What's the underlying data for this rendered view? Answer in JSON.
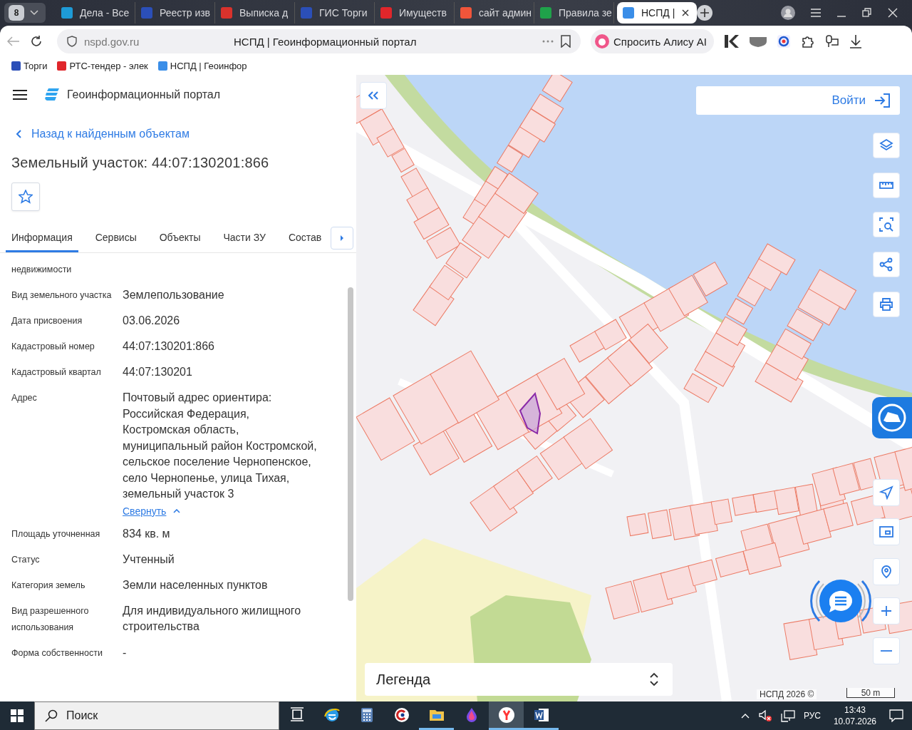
{
  "browser": {
    "tab_count": "8",
    "tabs": [
      {
        "title": "Дела - Все",
        "color": "#1e9bd7",
        "selected": false
      },
      {
        "title": "Реестр изв",
        "color": "#2b4fb8",
        "selected": false
      },
      {
        "title": "Выписка д",
        "color": "#d8322c",
        "selected": false
      },
      {
        "title": "ГИС Торги",
        "color": "#2b4fb8",
        "selected": false
      },
      {
        "title": "Имуществ",
        "color": "#e0262b",
        "selected": false
      },
      {
        "title": "сайт админ",
        "color": "#f0553a",
        "selected": false
      },
      {
        "title": "Правила зе",
        "color": "#1fa24a",
        "selected": false
      },
      {
        "title": "НСПД |",
        "color": "#3a8ee8",
        "selected": true
      }
    ],
    "address": {
      "host": "nspd.gov.ru",
      "page_title": "НСПД | Геоинформационный портал"
    },
    "alice_button": "Спросить Алису AI",
    "bookmarks": [
      {
        "title": "Торги",
        "color": "#2b4fb8"
      },
      {
        "title": "РТС-тендер - элек",
        "color": "#e0262b"
      },
      {
        "title": "НСПД | Геоинфор",
        "color": "#3a8ee8"
      }
    ]
  },
  "portal": {
    "title": "Геоинформационный портал",
    "back_link": "Назад к найденным объектам",
    "heading": "Земельный участок: 44:07:130201:866",
    "tabs": [
      {
        "label": "Информация",
        "selected": true
      },
      {
        "label": "Сервисы",
        "selected": false
      },
      {
        "label": "Объекты",
        "selected": false
      },
      {
        "label": "Части ЗУ",
        "selected": false
      },
      {
        "label": "Состав",
        "selected": false
      }
    ],
    "fields": [
      {
        "label": "недвижимости"
      },
      {
        "label": "Вид земельного участка",
        "value": "Землепользование"
      },
      {
        "label": "Дата присвоения",
        "value": "03.06.2026"
      },
      {
        "label": "Кадастровый номер",
        "value": "44:07:130201:866"
      },
      {
        "label": "Кадастровый квартал",
        "value": "44:07:130201"
      },
      {
        "label": "Адрес",
        "value": "Почтовый адрес ориентира:\nРоссийская Федерация,\nКостромская область,\nмуниципальный район Костромской,\nсельское поселение Чернопенское,\nсело Чернопенье, улица Тихая,\nземельный участок 3",
        "collapse_link": "Свернуть"
      },
      {
        "label": "Площадь уточненная",
        "value": "834 кв. м"
      },
      {
        "label": "Статус",
        "value": "Учтенный"
      },
      {
        "label": "Категория земель",
        "value": "Земли населенных пунктов"
      },
      {
        "label": "Вид разрешенного использования",
        "value": "Для индивидуального жилищного строительства"
      },
      {
        "label": "Форма собственности",
        "value": "-"
      }
    ]
  },
  "map": {
    "login_button": "Войти",
    "legend": "Легенда",
    "attribution": "НСПД 2026 ©",
    "scale": "50 m"
  },
  "taskbar": {
    "search_placeholder": "Поиск",
    "apps": [
      {
        "kind": "task-view",
        "running": false,
        "selected": false
      },
      {
        "kind": "browser-e",
        "running": false,
        "selected": false
      },
      {
        "kind": "calculator",
        "running": false,
        "selected": false
      },
      {
        "kind": "cleaner",
        "running": false,
        "selected": false
      },
      {
        "kind": "folder",
        "running": true,
        "selected": false
      },
      {
        "kind": "drop",
        "running": false,
        "selected": false
      },
      {
        "kind": "yandex",
        "running": true,
        "selected": true
      },
      {
        "kind": "word",
        "running": true,
        "selected": false
      }
    ],
    "language": "РУС",
    "time": "13:43",
    "date": "10.07.2026"
  }
}
